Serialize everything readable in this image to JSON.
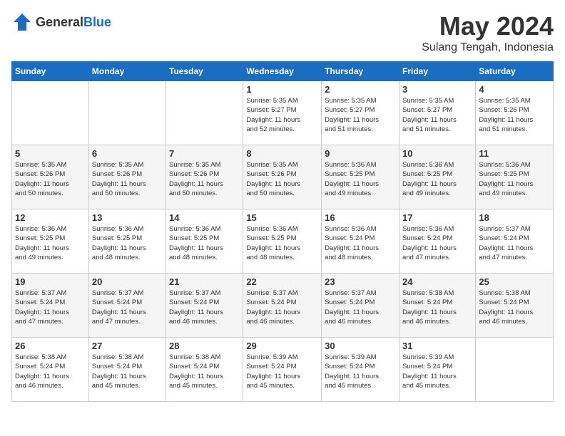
{
  "logo": {
    "text_general": "General",
    "text_blue": "Blue"
  },
  "title": {
    "month": "May 2024",
    "location": "Sulang Tengah, Indonesia"
  },
  "weekdays": [
    "Sunday",
    "Monday",
    "Tuesday",
    "Wednesday",
    "Thursday",
    "Friday",
    "Saturday"
  ],
  "weeks": [
    [
      {
        "day": "",
        "info": ""
      },
      {
        "day": "",
        "info": ""
      },
      {
        "day": "",
        "info": ""
      },
      {
        "day": "1",
        "info": "Sunrise: 5:35 AM\nSunset: 5:27 PM\nDaylight: 11 hours\nand 52 minutes."
      },
      {
        "day": "2",
        "info": "Sunrise: 5:35 AM\nSunset: 5:27 PM\nDaylight: 11 hours\nand 51 minutes."
      },
      {
        "day": "3",
        "info": "Sunrise: 5:35 AM\nSunset: 5:27 PM\nDaylight: 11 hours\nand 51 minutes."
      },
      {
        "day": "4",
        "info": "Sunrise: 5:35 AM\nSunset: 5:26 PM\nDaylight: 11 hours\nand 51 minutes."
      }
    ],
    [
      {
        "day": "5",
        "info": "Sunrise: 5:35 AM\nSunset: 5:26 PM\nDaylight: 11 hours\nand 50 minutes."
      },
      {
        "day": "6",
        "info": "Sunrise: 5:35 AM\nSunset: 5:26 PM\nDaylight: 11 hours\nand 50 minutes."
      },
      {
        "day": "7",
        "info": "Sunrise: 5:35 AM\nSunset: 5:26 PM\nDaylight: 11 hours\nand 50 minutes."
      },
      {
        "day": "8",
        "info": "Sunrise: 5:35 AM\nSunset: 5:26 PM\nDaylight: 11 hours\nand 50 minutes."
      },
      {
        "day": "9",
        "info": "Sunrise: 5:36 AM\nSunset: 5:25 PM\nDaylight: 11 hours\nand 49 minutes."
      },
      {
        "day": "10",
        "info": "Sunrise: 5:36 AM\nSunset: 5:25 PM\nDaylight: 11 hours\nand 49 minutes."
      },
      {
        "day": "11",
        "info": "Sunrise: 5:36 AM\nSunset: 5:25 PM\nDaylight: 11 hours\nand 49 minutes."
      }
    ],
    [
      {
        "day": "12",
        "info": "Sunrise: 5:36 AM\nSunset: 5:25 PM\nDaylight: 11 hours\nand 49 minutes."
      },
      {
        "day": "13",
        "info": "Sunrise: 5:36 AM\nSunset: 5:25 PM\nDaylight: 11 hours\nand 48 minutes."
      },
      {
        "day": "14",
        "info": "Sunrise: 5:36 AM\nSunset: 5:25 PM\nDaylight: 11 hours\nand 48 minutes."
      },
      {
        "day": "15",
        "info": "Sunrise: 5:36 AM\nSunset: 5:25 PM\nDaylight: 11 hours\nand 48 minutes."
      },
      {
        "day": "16",
        "info": "Sunrise: 5:36 AM\nSunset: 5:24 PM\nDaylight: 11 hours\nand 48 minutes."
      },
      {
        "day": "17",
        "info": "Sunrise: 5:36 AM\nSunset: 5:24 PM\nDaylight: 11 hours\nand 47 minutes."
      },
      {
        "day": "18",
        "info": "Sunrise: 5:37 AM\nSunset: 5:24 PM\nDaylight: 11 hours\nand 47 minutes."
      }
    ],
    [
      {
        "day": "19",
        "info": "Sunrise: 5:37 AM\nSunset: 5:24 PM\nDaylight: 11 hours\nand 47 minutes."
      },
      {
        "day": "20",
        "info": "Sunrise: 5:37 AM\nSunset: 5:24 PM\nDaylight: 11 hours\nand 47 minutes."
      },
      {
        "day": "21",
        "info": "Sunrise: 5:37 AM\nSunset: 5:24 PM\nDaylight: 11 hours\nand 46 minutes."
      },
      {
        "day": "22",
        "info": "Sunrise: 5:37 AM\nSunset: 5:24 PM\nDaylight: 11 hours\nand 46 minutes."
      },
      {
        "day": "23",
        "info": "Sunrise: 5:37 AM\nSunset: 5:24 PM\nDaylight: 11 hours\nand 46 minutes."
      },
      {
        "day": "24",
        "info": "Sunrise: 5:38 AM\nSunset: 5:24 PM\nDaylight: 11 hours\nand 46 minutes."
      },
      {
        "day": "25",
        "info": "Sunrise: 5:38 AM\nSunset: 5:24 PM\nDaylight: 11 hours\nand 46 minutes."
      }
    ],
    [
      {
        "day": "26",
        "info": "Sunrise: 5:38 AM\nSunset: 5:24 PM\nDaylight: 11 hours\nand 46 minutes."
      },
      {
        "day": "27",
        "info": "Sunrise: 5:38 AM\nSunset: 5:24 PM\nDaylight: 11 hours\nand 45 minutes."
      },
      {
        "day": "28",
        "info": "Sunrise: 5:38 AM\nSunset: 5:24 PM\nDaylight: 11 hours\nand 45 minutes."
      },
      {
        "day": "29",
        "info": "Sunrise: 5:39 AM\nSunset: 5:24 PM\nDaylight: 11 hours\nand 45 minutes."
      },
      {
        "day": "30",
        "info": "Sunrise: 5:39 AM\nSunset: 5:24 PM\nDaylight: 11 hours\nand 45 minutes."
      },
      {
        "day": "31",
        "info": "Sunrise: 5:39 AM\nSunset: 5:24 PM\nDaylight: 11 hours\nand 45 minutes."
      },
      {
        "day": "",
        "info": ""
      }
    ]
  ]
}
